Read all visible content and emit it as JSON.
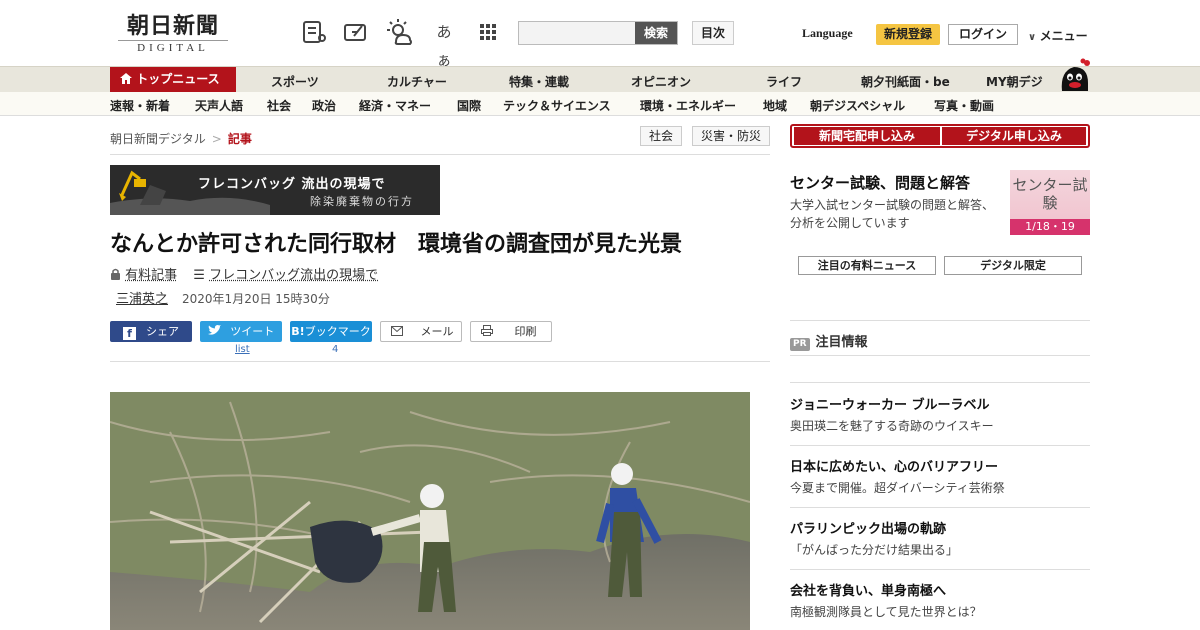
{
  "header": {
    "logo_kanji": "朝日新聞",
    "logo_digital": "DIGITAL",
    "font_size_icon_label": "あぁ",
    "search_placeholder": "",
    "search_button": "検索",
    "toc_button": "目次",
    "language": "Language",
    "register": "新規登録",
    "login": "ログイン",
    "menu": "メニュー"
  },
  "nav_primary": [
    {
      "label": "トップニュース"
    },
    {
      "label": "スポーツ"
    },
    {
      "label": "カルチャー"
    },
    {
      "label": "特集・連載"
    },
    {
      "label": "オピニオン"
    },
    {
      "label": "ライフ"
    },
    {
      "label": "朝夕刊紙面・be"
    },
    {
      "label": "MY朝デジ"
    }
  ],
  "nav_secondary": [
    {
      "label": "速報・新着"
    },
    {
      "label": "天声人語"
    },
    {
      "label": "社会"
    },
    {
      "label": "政治"
    },
    {
      "label": "経済・マネー"
    },
    {
      "label": "国際"
    },
    {
      "label": "テック＆サイエンス"
    },
    {
      "label": "環境・エネルギー"
    },
    {
      "label": "地域"
    },
    {
      "label": "朝デジスペシャル"
    },
    {
      "label": "写真・動画"
    }
  ],
  "article": {
    "breadcrumb_home": "朝日新聞デジタル",
    "breadcrumb_sep": ">",
    "breadcrumb_current": "記事",
    "tags": [
      "社会",
      "災害・防災"
    ],
    "banner_title": "フレコンバッグ 流出の現場で",
    "banner_subtitle": "除染廃棄物の行方",
    "headline": "なんとか許可された同行取材　環境省の調査団が見た光景",
    "paid_label": "有料記事",
    "series_label": "フレコンバッグ流出の現場で",
    "author": "三浦英之",
    "date": "2020年1月20日 15時30分"
  },
  "share": {
    "facebook": "シェア",
    "twitter": "ツイート",
    "twitter_count": "list",
    "hatena": "ブックマーク",
    "hatena_count": "4",
    "mail": "メール",
    "print": "印刷"
  },
  "sidebar": {
    "subscribe_paper": "新聞宅配申し込み",
    "subscribe_digital": "デジタル申し込み",
    "promo_title": "センター試験、問題と解答",
    "promo_desc": "大学入試センター試験の問題と解答、分析を公開しています",
    "promo_badge_title": "センター試験",
    "promo_badge_date": "1/18・19",
    "btn_paid_news": "注目の有料ニュース",
    "btn_digital_limited": "デジタル限定",
    "pr_badge": "PR",
    "pr_heading": "注目情報",
    "ads": [
      {
        "title": "ジョニーウォーカー ブルーラベル",
        "sub": "奥田瑛二を魅了する奇跡のウイスキー"
      },
      {
        "title": "日本に広めたい、心のバリアフリー",
        "sub": "今夏まで開催。超ダイバーシティ芸術祭"
      },
      {
        "title": "パラリンピック出場の軌跡",
        "sub": "「がんばった分だけ結果出る」"
      },
      {
        "title": "会社を背負い、単身南極へ",
        "sub": "南極観測隊員として見た世界とは？"
      }
    ]
  },
  "colors": {
    "brand_red": "#b3131b",
    "register_yellow": "#f5c542",
    "facebook": "#3b5998",
    "twitter": "#2e9fe0",
    "hatena": "#1a8fd6"
  }
}
